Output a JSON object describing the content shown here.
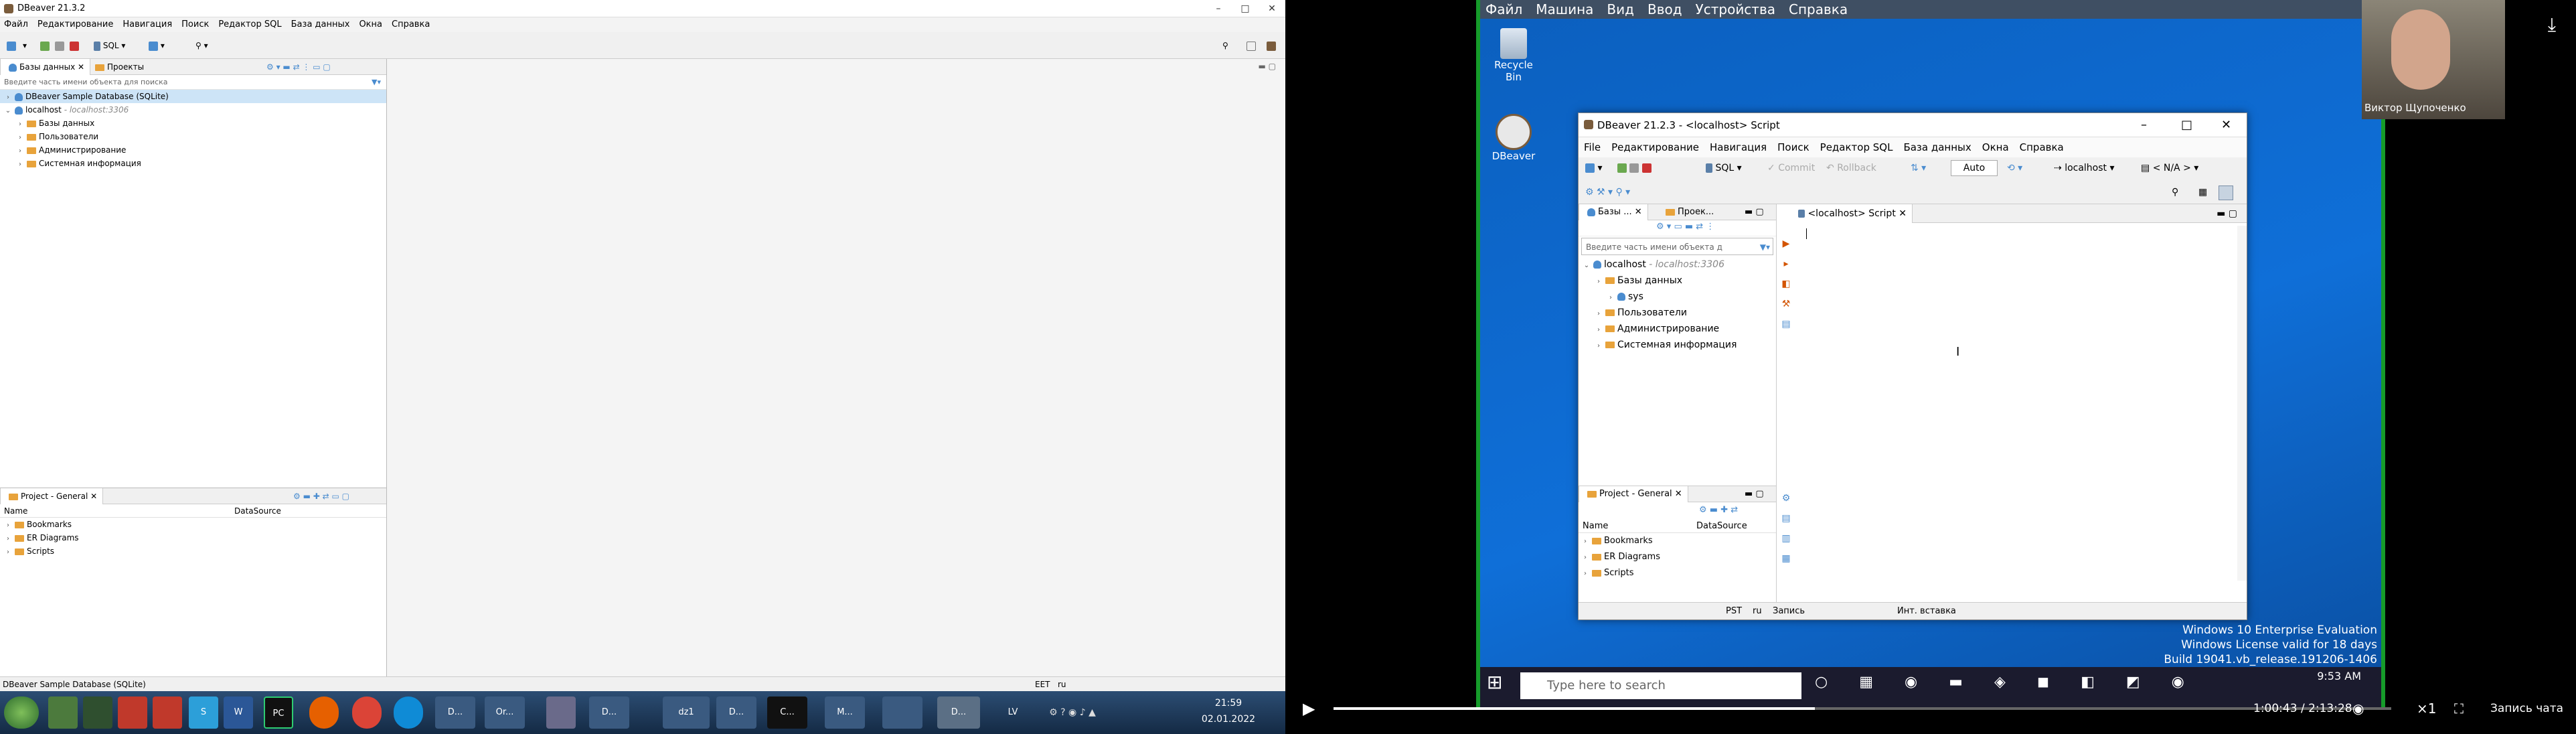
{
  "left": {
    "title": "DBeaver 21.3.2",
    "menu": [
      "Файл",
      "Редактирование",
      "Навигация",
      "Поиск",
      "Редактор SQL",
      "База данных",
      "Окна",
      "Справка"
    ],
    "toolbar": {
      "sql_label": "SQL"
    },
    "db_panel": {
      "tabs": [
        "Базы данных",
        "Проекты"
      ],
      "filter_placeholder": "Введите часть имени объекта для поиска",
      "tree": [
        {
          "label": "DBeaver Sample Database (SQLite)",
          "level": 0,
          "selected": true,
          "type": "db"
        },
        {
          "label": "localhost",
          "sub": " - localhost:3306",
          "level": 0,
          "expanded": true,
          "type": "db"
        },
        {
          "label": "Базы данных",
          "level": 1,
          "type": "folder"
        },
        {
          "label": "Пользователи",
          "level": 1,
          "type": "folder"
        },
        {
          "label": "Администрирование",
          "level": 1,
          "type": "folder"
        },
        {
          "label": "Системная информация",
          "level": 1,
          "type": "folder"
        }
      ]
    },
    "project_panel": {
      "tab": "Project - General",
      "columns": [
        "Name",
        "DataSource"
      ],
      "rows": [
        "Bookmarks",
        "ER Diagrams",
        "Scripts"
      ]
    },
    "status": {
      "left": "DBeaver Sample Database (SQLite)",
      "tz": "EET",
      "lang": "ru"
    },
    "taskbar": {
      "items": [
        "D...",
        "D...",
        "dz1",
        "D...",
        "C...",
        "M...",
        "Or...",
        "D..."
      ],
      "lang": "LV",
      "time": "21:59",
      "date": "02.01.2022"
    }
  },
  "vm": {
    "menu": [
      "Файл",
      "Машина",
      "Вид",
      "Ввод",
      "Устройства",
      "Справка"
    ],
    "desktop_icons": [
      "Recycle Bin",
      "DBeaver"
    ],
    "window": {
      "title": "DBeaver 21.2.3 - <localhost> Script",
      "menu": [
        "File",
        "Редактирование",
        "Навигация",
        "Поиск",
        "Редактор SQL",
        "База данных",
        "Окна",
        "Справка"
      ],
      "toolbar": {
        "sql": "SQL",
        "commit": "Commit",
        "rollback": "Rollback",
        "auto": "Auto",
        "conn": "localhost",
        "schema": "< N/A >"
      },
      "db_tabs": [
        "Базы ...",
        "Проек..."
      ],
      "filter_placeholder": "Введите часть имени объекта д",
      "tree": [
        {
          "label": "localhost",
          "sub": " - localhost:3306",
          "level": 0
        },
        {
          "label": "Базы данных",
          "level": 1
        },
        {
          "label": "sys",
          "level": 2
        },
        {
          "label": "Пользователи",
          "level": 1
        },
        {
          "label": "Администрирование",
          "level": 1
        },
        {
          "label": "Системная информация",
          "level": 1
        }
      ],
      "editor_tab": "<localhost> Script",
      "project_tab": "Project - General",
      "project_columns": [
        "Name",
        "DataSource"
      ],
      "project_rows": [
        "Bookmarks",
        "ER Diagrams",
        "Scripts"
      ],
      "status": [
        "PST",
        "ru",
        "Запись",
        "Инт. вставка"
      ]
    },
    "watermark": [
      "Windows 10 Enterprise Evaluation",
      "Windows License valid for 18 days",
      "Build 19041.vb_release.191206-1406"
    ],
    "taskbar": {
      "search": "Type here to search",
      "time": "9:53 AM"
    }
  },
  "video": {
    "time": "1:00:43 / 2:13:28",
    "progress": 0.455,
    "speed": "×1",
    "chat": "Запись чата",
    "presenter": "Виктор Щупоченко"
  }
}
